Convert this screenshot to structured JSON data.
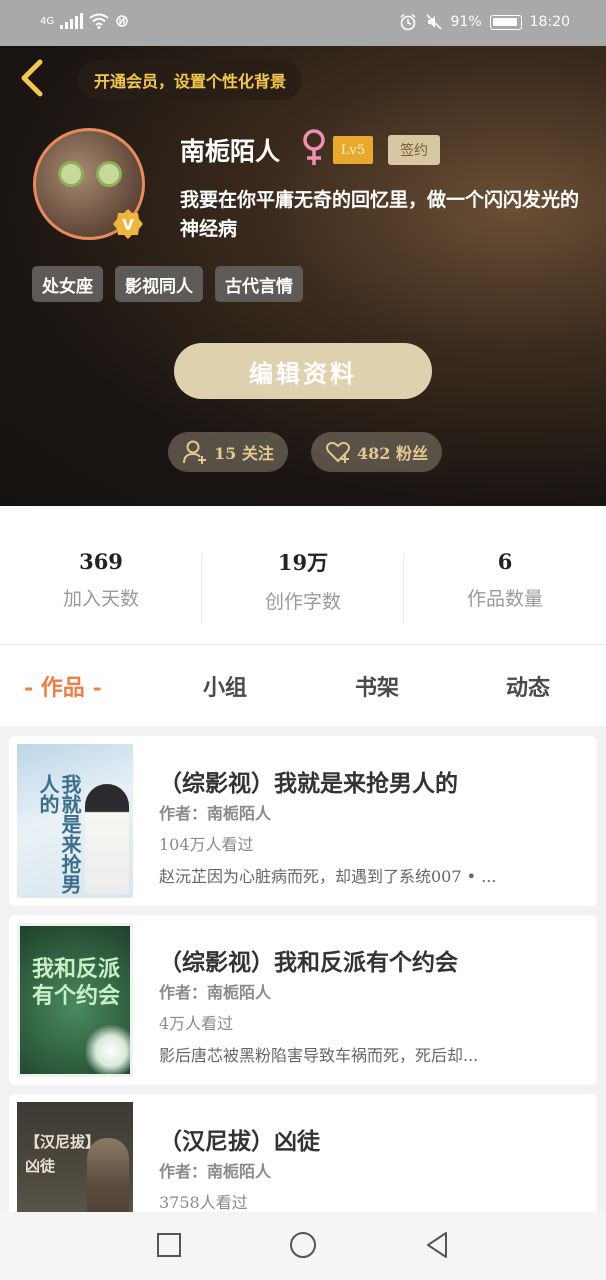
{
  "status_bar": {
    "network": "4G",
    "battery": "91%",
    "time": "18:20"
  },
  "header": {
    "vip_banner": "开通会员，设置个性化背景"
  },
  "profile": {
    "name": "南栀陌人",
    "level": "Lv5",
    "sign_badge": "签约",
    "bio": "我要在你平庸无奇的回忆里，做一个闪闪发光的神经病",
    "tags": [
      "处女座",
      "影视同人",
      "古代言情"
    ],
    "edit_button": "编辑资料",
    "following": "15 关注",
    "followers": "482 粉丝",
    "avatar_badge": "V"
  },
  "stats": [
    {
      "value": "369",
      "label": "加入天数"
    },
    {
      "value": "19万",
      "label": "创作字数"
    },
    {
      "value": "6",
      "label": "作品数量"
    }
  ],
  "tabs": [
    {
      "label": "- 作品 -",
      "active": true
    },
    {
      "label": "小组",
      "active": false
    },
    {
      "label": "书架",
      "active": false
    },
    {
      "label": "动态",
      "active": false
    }
  ],
  "books": [
    {
      "title": "（综影视）我就是来抢男人的",
      "author": "作者：南栀陌人",
      "views": "104万人看过",
      "desc": "赵沅芷因为心脏病而死，却遇到了系统007 • ...",
      "cover_text": "我就是来抢男人的"
    },
    {
      "title": "（综影视）我和反派有个约会",
      "author": "作者：南栀陌人",
      "views": "4万人看过",
      "desc": "影后唐芯被黑粉陷害导致车祸而死，死后却...",
      "cover_text": "我和反派有个约会"
    },
    {
      "title": "（汉尼拔）凶徒",
      "author": "作者：南栀陌人",
      "views": "3758人看过",
      "desc": "",
      "cover_text": "【汉尼拔】凶徒"
    }
  ],
  "colors": {
    "accent": "#ef7e45",
    "gold": "#f3c94a",
    "edit_button": "#e0d1ae"
  }
}
